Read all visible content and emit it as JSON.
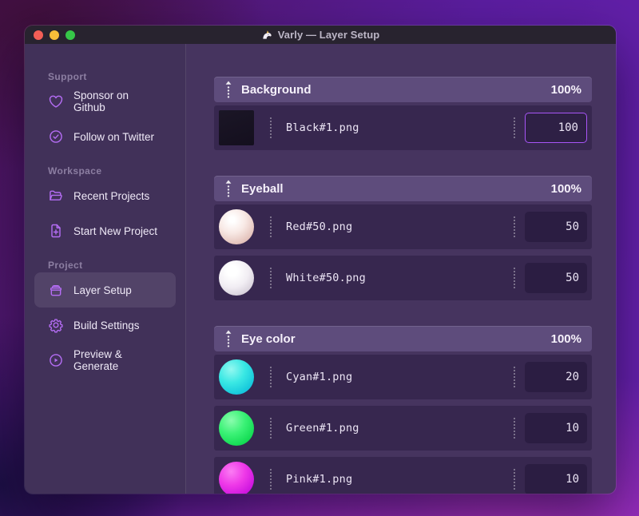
{
  "window": {
    "title": "Varly — Layer Setup",
    "app_icon": "unicorn-icon",
    "traffic_lights": [
      "close",
      "minimize",
      "zoom"
    ]
  },
  "colors": {
    "accent": "#a855f7",
    "sidebar_icon": "#b56df5",
    "window_main_bg": "#46345f",
    "sidebar_bg": "#413159",
    "group_header_bg": "#5e4c7c",
    "layer_row_bg": "#37274f",
    "titlebar_bg": "#28232f"
  },
  "sidebar": {
    "sections": [
      {
        "label": "Support",
        "items": [
          {
            "label": "Sponsor on Github",
            "icon": "heart-icon"
          },
          {
            "label": "Follow on Twitter",
            "icon": "badge-check-icon"
          }
        ]
      },
      {
        "label": "Workspace",
        "items": [
          {
            "label": "Recent Projects",
            "icon": "folder-icon"
          },
          {
            "label": "Start New Project",
            "icon": "document-plus-icon"
          }
        ]
      },
      {
        "label": "Project",
        "items": [
          {
            "label": "Layer Setup",
            "icon": "archive-box-icon",
            "active": true
          },
          {
            "label": "Build Settings",
            "icon": "gear-icon"
          },
          {
            "label": "Preview & Generate",
            "icon": "play-circle-icon"
          }
        ]
      }
    ]
  },
  "main": {
    "groups": [
      {
        "name": "Background",
        "weight": "100%",
        "layers": [
          {
            "file": "Black#1.png",
            "value": "100",
            "thumb": "black-square",
            "focused": true
          }
        ]
      },
      {
        "name": "Eyeball",
        "weight": "100%",
        "layers": [
          {
            "file": "Red#50.png",
            "value": "50",
            "thumb": "red-sphere"
          },
          {
            "file": "White#50.png",
            "value": "50",
            "thumb": "white-sphere"
          }
        ]
      },
      {
        "name": "Eye color",
        "weight": "100%",
        "layers": [
          {
            "file": "Cyan#1.png",
            "value": "20",
            "thumb": "cyan-circle"
          },
          {
            "file": "Green#1.png",
            "value": "10",
            "thumb": "green-circle"
          },
          {
            "file": "Pink#1.png",
            "value": "10",
            "thumb": "pink-circle"
          }
        ]
      }
    ]
  }
}
